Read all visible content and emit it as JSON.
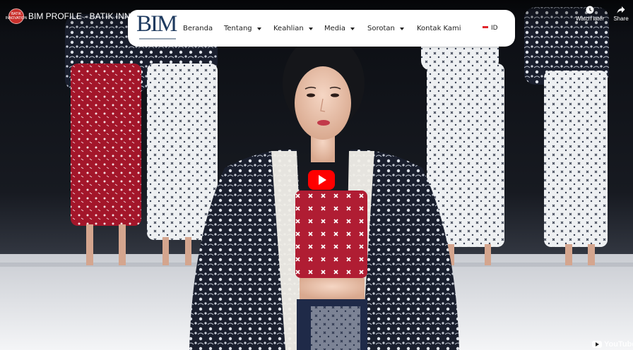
{
  "video": {
    "title": "BIM PROFILE - BATIK INNOVATION",
    "channel_avatar_text": "BATIK INNOVATION",
    "watch_later_label": "Watch later",
    "share_label": "Share",
    "watermark_label": "YouTube"
  },
  "site_nav": {
    "logo_text": "BIM",
    "items": [
      {
        "label": "Beranda",
        "has_dropdown": false
      },
      {
        "label": "Tentang",
        "has_dropdown": true
      },
      {
        "label": "Keahlian",
        "has_dropdown": true
      },
      {
        "label": "Media",
        "has_dropdown": true
      },
      {
        "label": "Sorotan",
        "has_dropdown": true
      },
      {
        "label": "Kontak Kami",
        "has_dropdown": false
      }
    ],
    "language": "ID"
  },
  "colors": {
    "play_button": "#ff0000",
    "logo_navy": "#1e3a5f",
    "nav_bg": "#ffffff",
    "flag_red": "#e1252c"
  },
  "icons": [
    "channel-avatar",
    "clock-icon",
    "share-arrow-icon",
    "play-icon",
    "youtube-logo-icon",
    "indonesia-flag-icon"
  ]
}
